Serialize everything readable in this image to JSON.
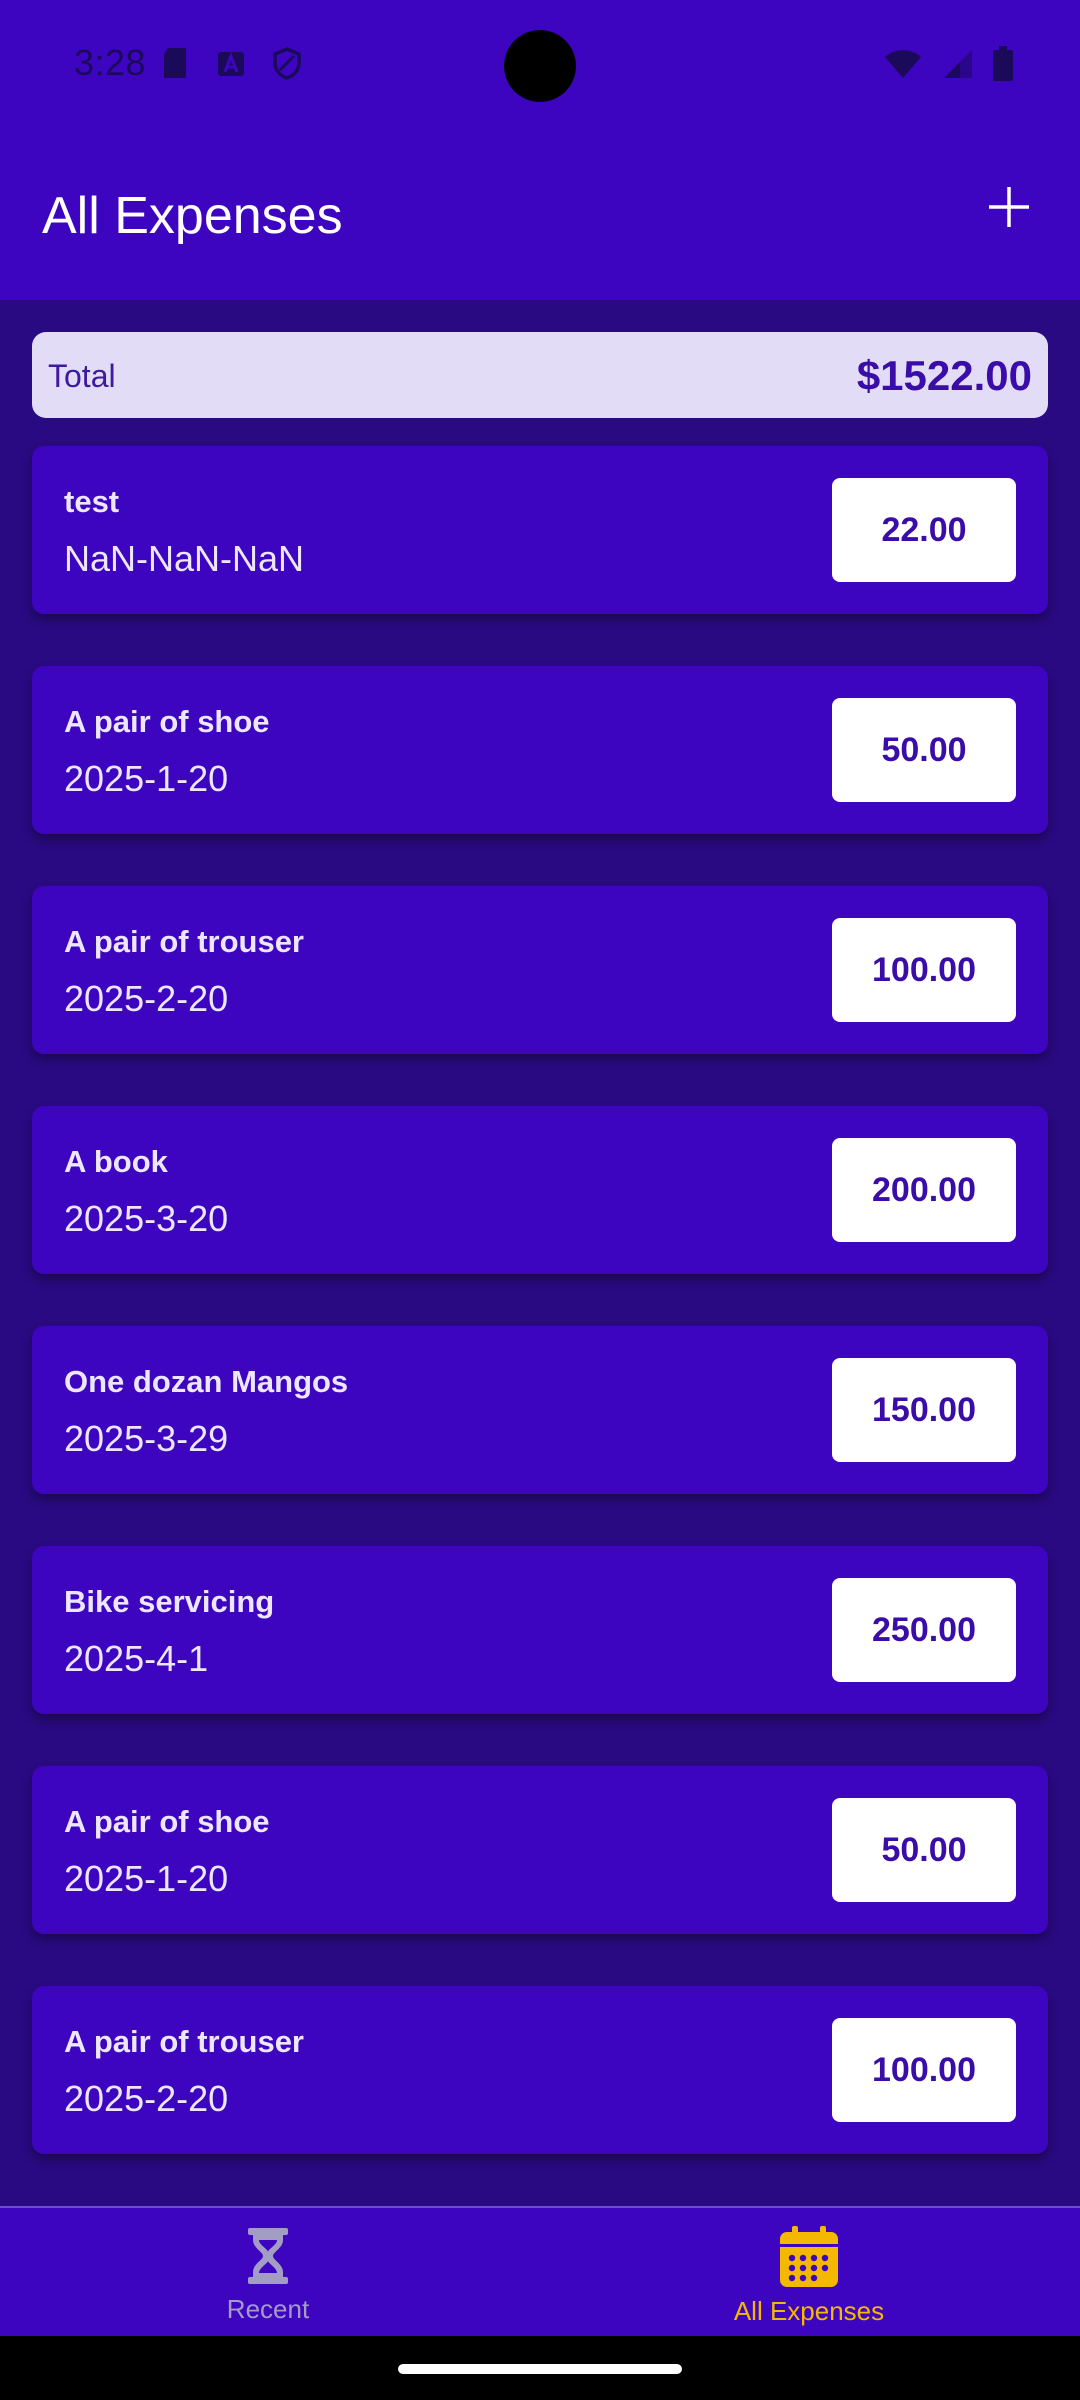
{
  "status_bar": {
    "time": "3:28",
    "left_icons": [
      "sd-card-icon",
      "font-a-icon",
      "shield-icon"
    ],
    "right_icons": [
      "wifi-icon",
      "signal-icon",
      "battery-icon"
    ]
  },
  "app_bar": {
    "title": "All Expenses",
    "add_icon": "plus-icon"
  },
  "total": {
    "label": "Total",
    "value": "$1522.00"
  },
  "expenses": [
    {
      "title": "test",
      "date": "NaN-NaN-NaN",
      "amount": "22.00"
    },
    {
      "title": "A pair of shoe",
      "date": "2025-1-20",
      "amount": "50.00"
    },
    {
      "title": "A pair of trouser",
      "date": "2025-2-20",
      "amount": "100.00"
    },
    {
      "title": "A book",
      "date": "2025-3-20",
      "amount": "200.00"
    },
    {
      "title": "One dozan Mangos",
      "date": "2025-3-29",
      "amount": "150.00"
    },
    {
      "title": "Bike servicing",
      "date": "2025-4-1",
      "amount": "250.00"
    },
    {
      "title": "A pair of shoe",
      "date": "2025-1-20",
      "amount": "50.00"
    },
    {
      "title": "A pair of trouser",
      "date": "2025-2-20",
      "amount": "100.00"
    }
  ],
  "bottom_nav": {
    "items": [
      {
        "label": "Recent",
        "icon": "hourglass-icon",
        "active": false
      },
      {
        "label": "All Expenses",
        "icon": "calendar-icon",
        "active": true
      }
    ]
  },
  "colors": {
    "primary": "#3d05c0",
    "background": "#2a0a82",
    "accent": "#f5b800",
    "total_card": "#e2dcf7"
  }
}
